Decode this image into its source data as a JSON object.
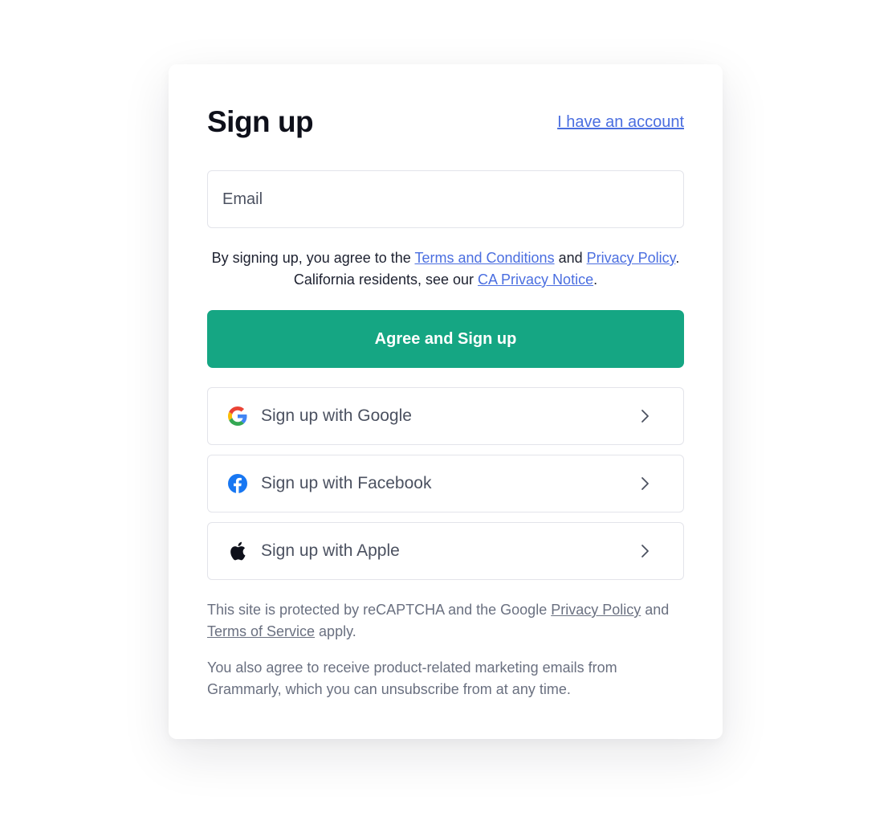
{
  "header": {
    "title": "Sign up",
    "account_link": "I have an account"
  },
  "email": {
    "placeholder": "Email",
    "value": ""
  },
  "terms": {
    "prefix": "By signing up, you agree to the ",
    "terms_link": "Terms and Conditions",
    "and": " and ",
    "privacy_link": "Privacy Policy",
    "middle": ". California residents, see our ",
    "ca_link": "CA Privacy Notice",
    "suffix": "."
  },
  "primary_button": {
    "label": "Agree and Sign up",
    "color": "#15a683"
  },
  "social_buttons": [
    {
      "label": "Sign up with Google",
      "icon": "google-icon"
    },
    {
      "label": "Sign up with Facebook",
      "icon": "facebook-icon"
    },
    {
      "label": "Sign up with Apple",
      "icon": "apple-icon"
    }
  ],
  "recaptcha": {
    "prefix": "This site is protected by reCAPTCHA and the Google ",
    "privacy_link": "Privacy Policy",
    "middle": " and ",
    "tos_link": "Terms of Service",
    "suffix": " apply."
  },
  "marketing": {
    "text": "You also agree to receive product-related marketing emails from Grammarly, which you can unsubscribe from at any time."
  },
  "colors": {
    "link": "#4a6ee0",
    "title": "#0e101a",
    "border": "#e3e4ea"
  }
}
